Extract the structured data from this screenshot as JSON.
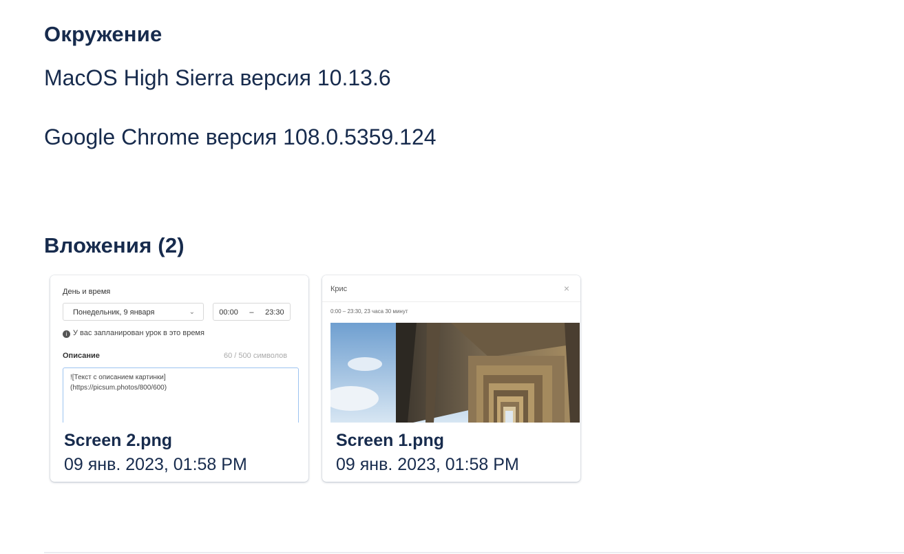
{
  "environment": {
    "title": "Окружение",
    "lines": [
      "MacOS High Sierra версия 10.13.6",
      "Google Chrome версия 108.0.5359.124"
    ]
  },
  "attachments": {
    "title": "Вложения (2)",
    "items": [
      {
        "name": "Screen 2.png",
        "date": "09 янв. 2023, 01:58 PM",
        "preview": {
          "label": "День и время",
          "select_value": "Понедельник, 9 января",
          "time_from": "00:00",
          "time_sep": "–",
          "time_to": "23:30",
          "note": "У вас запланирован урок в это время",
          "desc_label": "Описание",
          "counter": "60 / 500 символов",
          "textarea_line1": "![Текст с описанием картинки]",
          "textarea_line2": "(https://picsum.photos/800/600)"
        }
      },
      {
        "name": "Screen 1.png",
        "date": "09 янв. 2023, 01:58 PM",
        "preview": {
          "header": "Крис",
          "close": "×",
          "subtitle": "0:00 – 23:30, 23 часа 30 минут"
        }
      }
    ]
  },
  "colors": {
    "text": "#172b4d",
    "card_shadow": "#091e42",
    "focus_border": "#9cc3f0"
  }
}
